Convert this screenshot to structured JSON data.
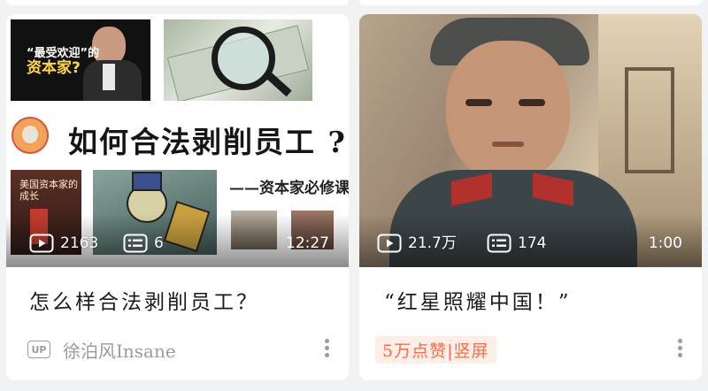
{
  "cards": [
    {
      "thumbnail": {
        "musk_caption_line1": "“最受欢迎”的",
        "musk_caption_line2": "资本家?",
        "heading": "如何合法剥削员工 ?",
        "subheading": "——资本家必修课",
        "book_text": "美国资本家的成长"
      },
      "play_count": "2163",
      "danmaku_count": "6",
      "duration": "12:27",
      "title": "怎么样合法剥削员工？",
      "up_badge": "UP",
      "author": "徐泊风Insane"
    },
    {
      "thumbnail": {},
      "play_count": "21.7万",
      "danmaku_count": "174",
      "duration": "1:00",
      "title": "“红星照耀中国！”",
      "tag": "5万点赞|竖屏"
    }
  ],
  "colors": {
    "page_bg": "#f1f2f3",
    "tag_text": "#ff6a45",
    "tag_bg": "#fdeee8",
    "meta_gray": "#9b9b9b"
  },
  "icons": [
    "play-count-icon",
    "danmaku-icon",
    "more-options-icon",
    "up-badge-icon"
  ]
}
